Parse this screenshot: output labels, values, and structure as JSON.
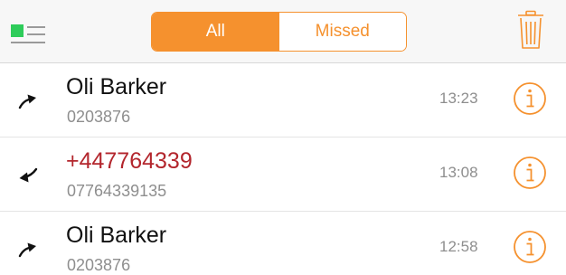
{
  "header": {
    "filter_icon": "list-filter-icon",
    "tabs": [
      {
        "label": "All",
        "active": true
      },
      {
        "label": "Missed",
        "active": false
      }
    ],
    "trash_icon": "trash-icon"
  },
  "colors": {
    "accent": "#f5912e",
    "missed": "#b3262d",
    "indicator_green": "#2ecc5a"
  },
  "calls": [
    {
      "direction": "outgoing",
      "name": "Oli Barker",
      "number": "0203876",
      "time": "13:23",
      "missed": false
    },
    {
      "direction": "incoming-missed",
      "name": "+447764339",
      "number": "07764339135",
      "time": "13:08",
      "missed": true
    },
    {
      "direction": "outgoing",
      "name": "Oli Barker",
      "number": "0203876",
      "time": "12:58",
      "missed": false
    }
  ]
}
